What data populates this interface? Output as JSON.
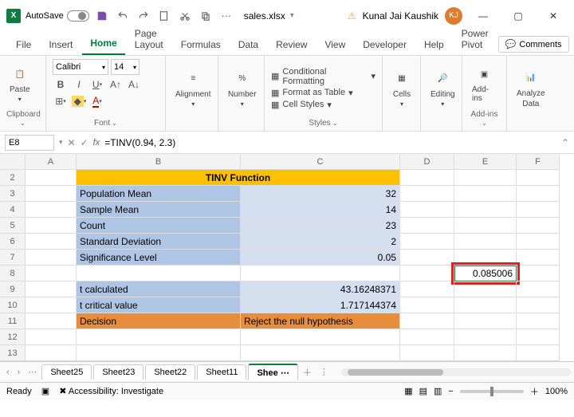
{
  "titlebar": {
    "autosave_label": "AutoSave",
    "filename": "sales.xlsx",
    "username": "Kunal Jai Kaushik",
    "avatar_initials": "KJ"
  },
  "menu": {
    "file": "File",
    "insert": "Insert",
    "home": "Home",
    "page_layout": "Page Layout",
    "formulas": "Formulas",
    "data": "Data",
    "review": "Review",
    "view": "View",
    "developer": "Developer",
    "help": "Help",
    "power_pivot": "Power Pivot",
    "comments": "Comments"
  },
  "ribbon": {
    "clipboard": {
      "label": "Clipboard",
      "paste": "Paste"
    },
    "font": {
      "label": "Font",
      "name": "Calibri",
      "size": "14"
    },
    "alignment": {
      "label": "Alignment"
    },
    "number": {
      "label": "Number"
    },
    "styles": {
      "label": "Styles",
      "cf": "Conditional Formatting",
      "ft": "Format as Table",
      "cs": "Cell Styles"
    },
    "cells": {
      "label": "Cells"
    },
    "editing": {
      "label": "Editing"
    },
    "addins": {
      "label": "Add-ins",
      "btn": "Add-ins"
    },
    "analyze": {
      "label": "Analyze Data",
      "btn1": "Analyze",
      "btn2": "Data"
    }
  },
  "formula_bar": {
    "cell_ref": "E8",
    "formula": "=TINV(0.94, 2.3)"
  },
  "columns": [
    "A",
    "B",
    "C",
    "D",
    "E",
    "F"
  ],
  "rows": [
    "2",
    "3",
    "4",
    "5",
    "6",
    "7",
    "8",
    "9",
    "10",
    "11",
    "12",
    "13"
  ],
  "sheet": {
    "title": "TINV Function",
    "r3b": "Population Mean",
    "r3c": "32",
    "r4b": "Sample Mean",
    "r4c": "14",
    "r5b": "Count",
    "r5c": "23",
    "r6b": "Standard Deviation",
    "r6c": "2",
    "r7b": "Significance Level",
    "r7c": "0.05",
    "r8e": "0.085006",
    "r9b": "t calculated",
    "r9c": "43.16248371",
    "r10b": "t critical value",
    "r10c": "1.717144374",
    "r11b": "Decision",
    "r11c": "Reject the null hypothesis"
  },
  "sheets": {
    "s25": "Sheet25",
    "s23": "Sheet23",
    "s22": "Sheet22",
    "s11": "Sheet11",
    "active_prefix": "Shee"
  },
  "status": {
    "ready": "Ready",
    "accessibility": "Accessibility: Investigate",
    "zoom": "100%"
  }
}
